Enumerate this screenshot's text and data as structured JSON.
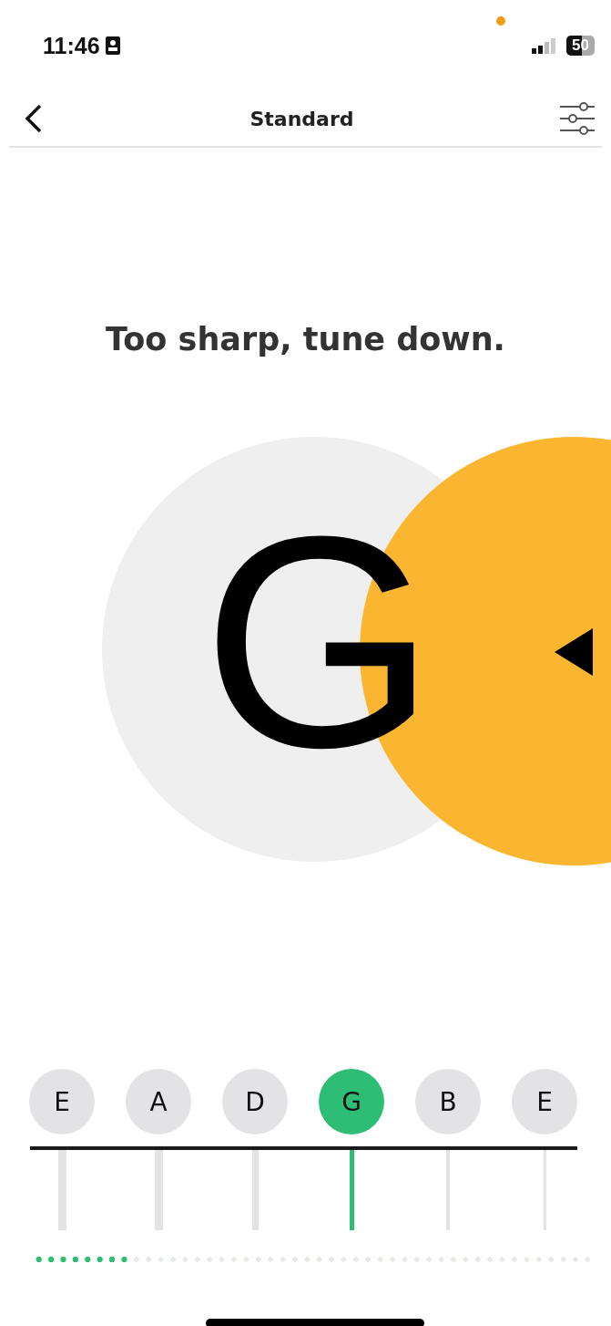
{
  "status_bar": {
    "time": "11:46",
    "battery": "50"
  },
  "nav": {
    "title": "Standard"
  },
  "tuner": {
    "message": "Too sharp, tune down.",
    "note": "G"
  },
  "strings": [
    {
      "label": "E",
      "selected": false
    },
    {
      "label": "A",
      "selected": false
    },
    {
      "label": "D",
      "selected": false
    },
    {
      "label": "G",
      "selected": true
    },
    {
      "label": "B",
      "selected": false
    },
    {
      "label": "E",
      "selected": false
    }
  ],
  "progress": {
    "level": 0.17
  }
}
